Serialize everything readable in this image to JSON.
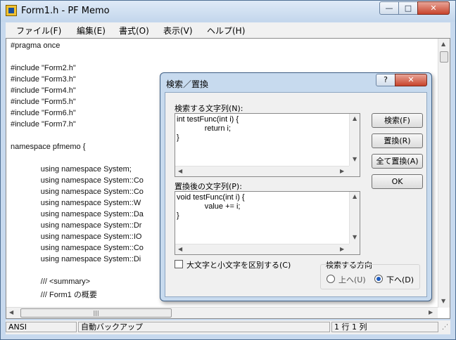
{
  "window": {
    "title": "Form1.h - PF Memo",
    "minimize_glyph": "—",
    "maximize_glyph": "□",
    "close_glyph": "✕"
  },
  "menu": [
    "ファイル(F)",
    "編集(E)",
    "書式(O)",
    "表示(V)",
    "ヘルプ(H)"
  ],
  "editor": {
    "lines": [
      "#pragma once",
      "",
      "#include \"Form2.h\"",
      "#include \"Form3.h\"",
      "#include \"Form4.h\"",
      "#include \"Form5.h\"",
      "#include \"Form6.h\"",
      "#include \"Form7.h\"",
      "",
      "namespace pfmemo {",
      "",
      "              using namespace System;",
      "              using namespace System::Co",
      "              using namespace System::Co",
      "              using namespace System::W",
      "              using namespace System::Da",
      "              using namespace System::Dr",
      "              using namespace System::IO",
      "              using namespace System::Co",
      "              using namespace System::Di",
      "",
      "              /// <summary>",
      "              /// Form1 の概要"
    ]
  },
  "status": {
    "encoding": "ANSI",
    "backup": "自動バックアップ",
    "position": "1 行  1 列"
  },
  "dialog": {
    "title": "検索／置換",
    "help_glyph": "?",
    "close_glyph": "✕",
    "find_label": "検索する文字列(N):",
    "find_text": [
      "int testFunc(int i) {",
      "             return i;",
      "}"
    ],
    "replace_label": "置換後の文字列(P):",
    "replace_text": [
      "void testFunc(int i) {",
      "             value += i;",
      "}"
    ],
    "buttons": {
      "find": "検索(F)",
      "replace": "置換(R)",
      "replace_all": "全て置換(A)",
      "ok": "OK"
    },
    "case_label": "大文字と小文字を区別する(C)",
    "case_checked": false,
    "direction": {
      "label": "検索する方向",
      "up": "上へ(U)",
      "down": "下へ(D)",
      "selected": "down"
    }
  }
}
